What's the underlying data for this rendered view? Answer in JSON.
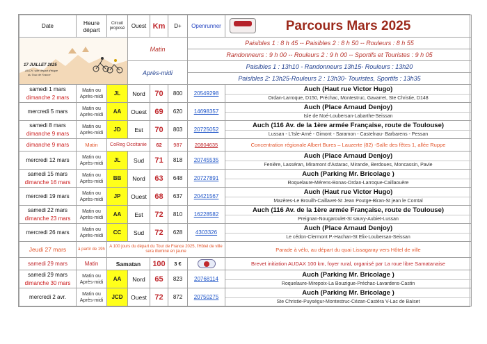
{
  "header": {
    "date": "Date",
    "heure": "Heure départ",
    "circuit": "Circuit proposé",
    "ouest": "Ouest",
    "km": "Km",
    "dplus": "D+",
    "openrunner": "Openrunner",
    "title": "Parcours  Mars 2025"
  },
  "banner": {
    "date_line": "17 JUILLET 2025",
    "line2": "AUCH, ville départ d'étape",
    "line3": "du Tour de France"
  },
  "schedule": {
    "matin_label": "Matin",
    "apres_midi_label": "Après-midi",
    "matin_lines": [
      "Paisibles 1 : 8 h 45 -- Paisibles 2 : 8 h 50 -- Rouleurs : 8 h 55",
      "Randonneurs : 9 h 00  -- Rouleurs 2 : 9 h 00  -- Sportifs et Touristes : 9 h 05"
    ],
    "apres_midi_lines": [
      "Paisibles 1 : 13h10 - Randonneurs 13h15- Rouleurs : 13h20",
      "Paisibles 2: 13h25-Rouleurs 2 : 13h30- Touristes, Sportifs : 13h35"
    ]
  },
  "rows": [
    {
      "date1": "samedi 1 mars",
      "date2": "dimanche 2 mars",
      "time": "Matin ou Après-midi",
      "code": "JL",
      "dir": "Nord",
      "km": "70",
      "dplus": "800",
      "link": "20549298",
      "dest": "Auch (Haut rue Victor Hugo)",
      "route": "Ordan-Larroque, D150, Préchac, Montestruc, Gavarret, Ste Christie, D148"
    },
    {
      "date1": "mercredi 5 mars",
      "date2": "",
      "time": "Matin ou Après-midi",
      "code": "AA",
      "dir": "Ouest",
      "km": "69",
      "dplus": "620",
      "link": "14698357",
      "dest": "Auch (Place Arnaud Denjoy)",
      "route": "Isle de Noé-Loubersan-Labarthe-Seissan"
    },
    {
      "date1": "samedi 8 mars",
      "date2": "dimanche 9 mars",
      "time": "Matin ou Après-midi",
      "code": "JD",
      "dir": "Est",
      "km": "70",
      "dplus": "803",
      "link": "20725052",
      "dest": "Auch (116 Av. de la 1ère armée Française, route de Toulouse)",
      "route": "Lussan - L'Isle-Arné - Gimont - Saramon - Castelnau- Barbarens - Pessan"
    }
  ],
  "special": {
    "date": "dimanche 9 mars",
    "time": "Matin",
    "code": "CoReg Occitanie",
    "km": "62",
    "dplus": "987",
    "link": "20804635",
    "text": "Concentration régionale Albert Bures – Lauzerte (82) -Salle des fêtes 1, allée Ruppe"
  },
  "rows2": [
    {
      "date1": "mercredi 12 mars",
      "date2": "",
      "time": "Matin ou Après-midi",
      "code": "JL",
      "dir": "Sud",
      "km": "71",
      "dplus": "818",
      "link": "20745535",
      "dest": "Auch (Place Arnaud Denjoy)",
      "route": "Fenière, Lasséran, Miramont d'Astarac, Mirande, Berdoues, Moncassin, Pavie"
    },
    {
      "date1": "samedi 15 mars",
      "date2": "dimanche 16 mars",
      "time": "Matin ou Après-midi",
      "code": "BB",
      "dir": "Nord",
      "km": "63",
      "dplus": "648",
      "link": "20727891",
      "dest": "Auch (Parking Mr. Bricolage )",
      "route": "Roquelaure-Mérens-Bonas-Ordan-Larroque-Caillaouère"
    },
    {
      "date1": "mercredi 19 mars",
      "date2": "",
      "time": "Matin ou Après-midi",
      "code": "JP",
      "dir": "Ouest",
      "km": "68",
      "dplus": "637",
      "link": "20421567",
      "dest": "Auch (Haut rue Victor Hugo)",
      "route": "Mazères-Le Brouilh-Caillavet-St Jean Poutge-Biran-St jean le Comtal"
    },
    {
      "date1": "samedi 22 mars",
      "date2": "dimanche 23 mars",
      "time": "Matin ou Après-midi",
      "code": "AA",
      "dir": "Est",
      "km": "72",
      "dplus": "810",
      "link": "16228582",
      "dest": "Auch (116 Av. de la 1ère armée Française, route de Toulouse)",
      "route": "Preignan-Nougaroulet-St sauvy-Aubiet-Lussan"
    },
    {
      "date1": "mercredi 26 mars",
      "date2": "",
      "time": "Matin ou Après-midi",
      "code": "CC",
      "dir": "Sud",
      "km": "72",
      "dplus": "628",
      "link": "4303326",
      "dest": "Auch (Place Arnaud Denjoy)",
      "route": "Le cédon-Clermont P.-Hachan-St Elix-Loubersan-Seissan"
    }
  ],
  "jeudi": {
    "date": "Jeudi 27 mars",
    "time": "à partir de 19h",
    "note": "A 100 jours du départ du Tour de France 2025, l'Hôtel de ville sera illuminé en jaune",
    "text": "Parade à vélo, au départ du quai Lissagaray vers Hôtel de ville"
  },
  "samatan": {
    "date": "samedi 29 mars",
    "time": "Matin",
    "place": "Samatan",
    "km": "100",
    "price": "3 €",
    "text": "Brevet initiation AUDAX 100 km, foyer rural,  organisé par La roue libre Samatanaise"
  },
  "rows3": [
    {
      "date1": "samedi 29 mars",
      "date2": "dimanche 30 mars",
      "time": "Matin ou Après-midi",
      "code": "AA",
      "dir": "Nord",
      "km": "65",
      "dplus": "823",
      "link": "20768114",
      "dest": "Auch (Parking Mr. Bricolage )",
      "route": "Roquelaure-Mirepoix-La Bouzigue-Préchac-Lavardens-Castin"
    },
    {
      "date1": "mercredi 2 avr.",
      "date2": "",
      "time": "Matin ou Après-midi",
      "code": "JCD",
      "dir": "Ouest",
      "km": "72",
      "dplus": "872",
      "link": "20750275",
      "dest": "Auch (Parking Mr. Bricolage )",
      "route": "Ste Christie-Puységur-Montestruc-Cézan-Castéra V-Lac de Baïset"
    }
  ],
  "colors": {
    "accent_red": "#c0282d",
    "title_brown": "#9c2a1c",
    "link_blue": "#1f55c8",
    "code_yellow": "#ffff1a"
  }
}
